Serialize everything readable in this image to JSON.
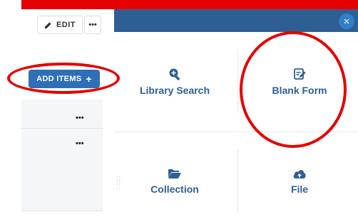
{
  "toolbar": {
    "edit_label": "EDIT",
    "more_label": "•••"
  },
  "add_items": {
    "label": "ADD ITEMS",
    "plus": "+"
  },
  "list": {
    "rows": [
      {
        "more": "•••"
      },
      {
        "more": "•••"
      }
    ]
  },
  "modal": {
    "close_glyph": "×",
    "tiles": [
      {
        "label": "Library Search",
        "icon": "search-plus-icon"
      },
      {
        "label": "Blank Form",
        "icon": "edit-form-icon"
      },
      {
        "label": "Collection",
        "icon": "folder-open-icon"
      },
      {
        "label": "File",
        "icon": "cloud-upload-icon"
      }
    ]
  },
  "colors": {
    "header": "#2e5f94",
    "accent": "#2e6fb7",
    "highlight": "#e60000",
    "tile_text": "#2e5f94"
  }
}
